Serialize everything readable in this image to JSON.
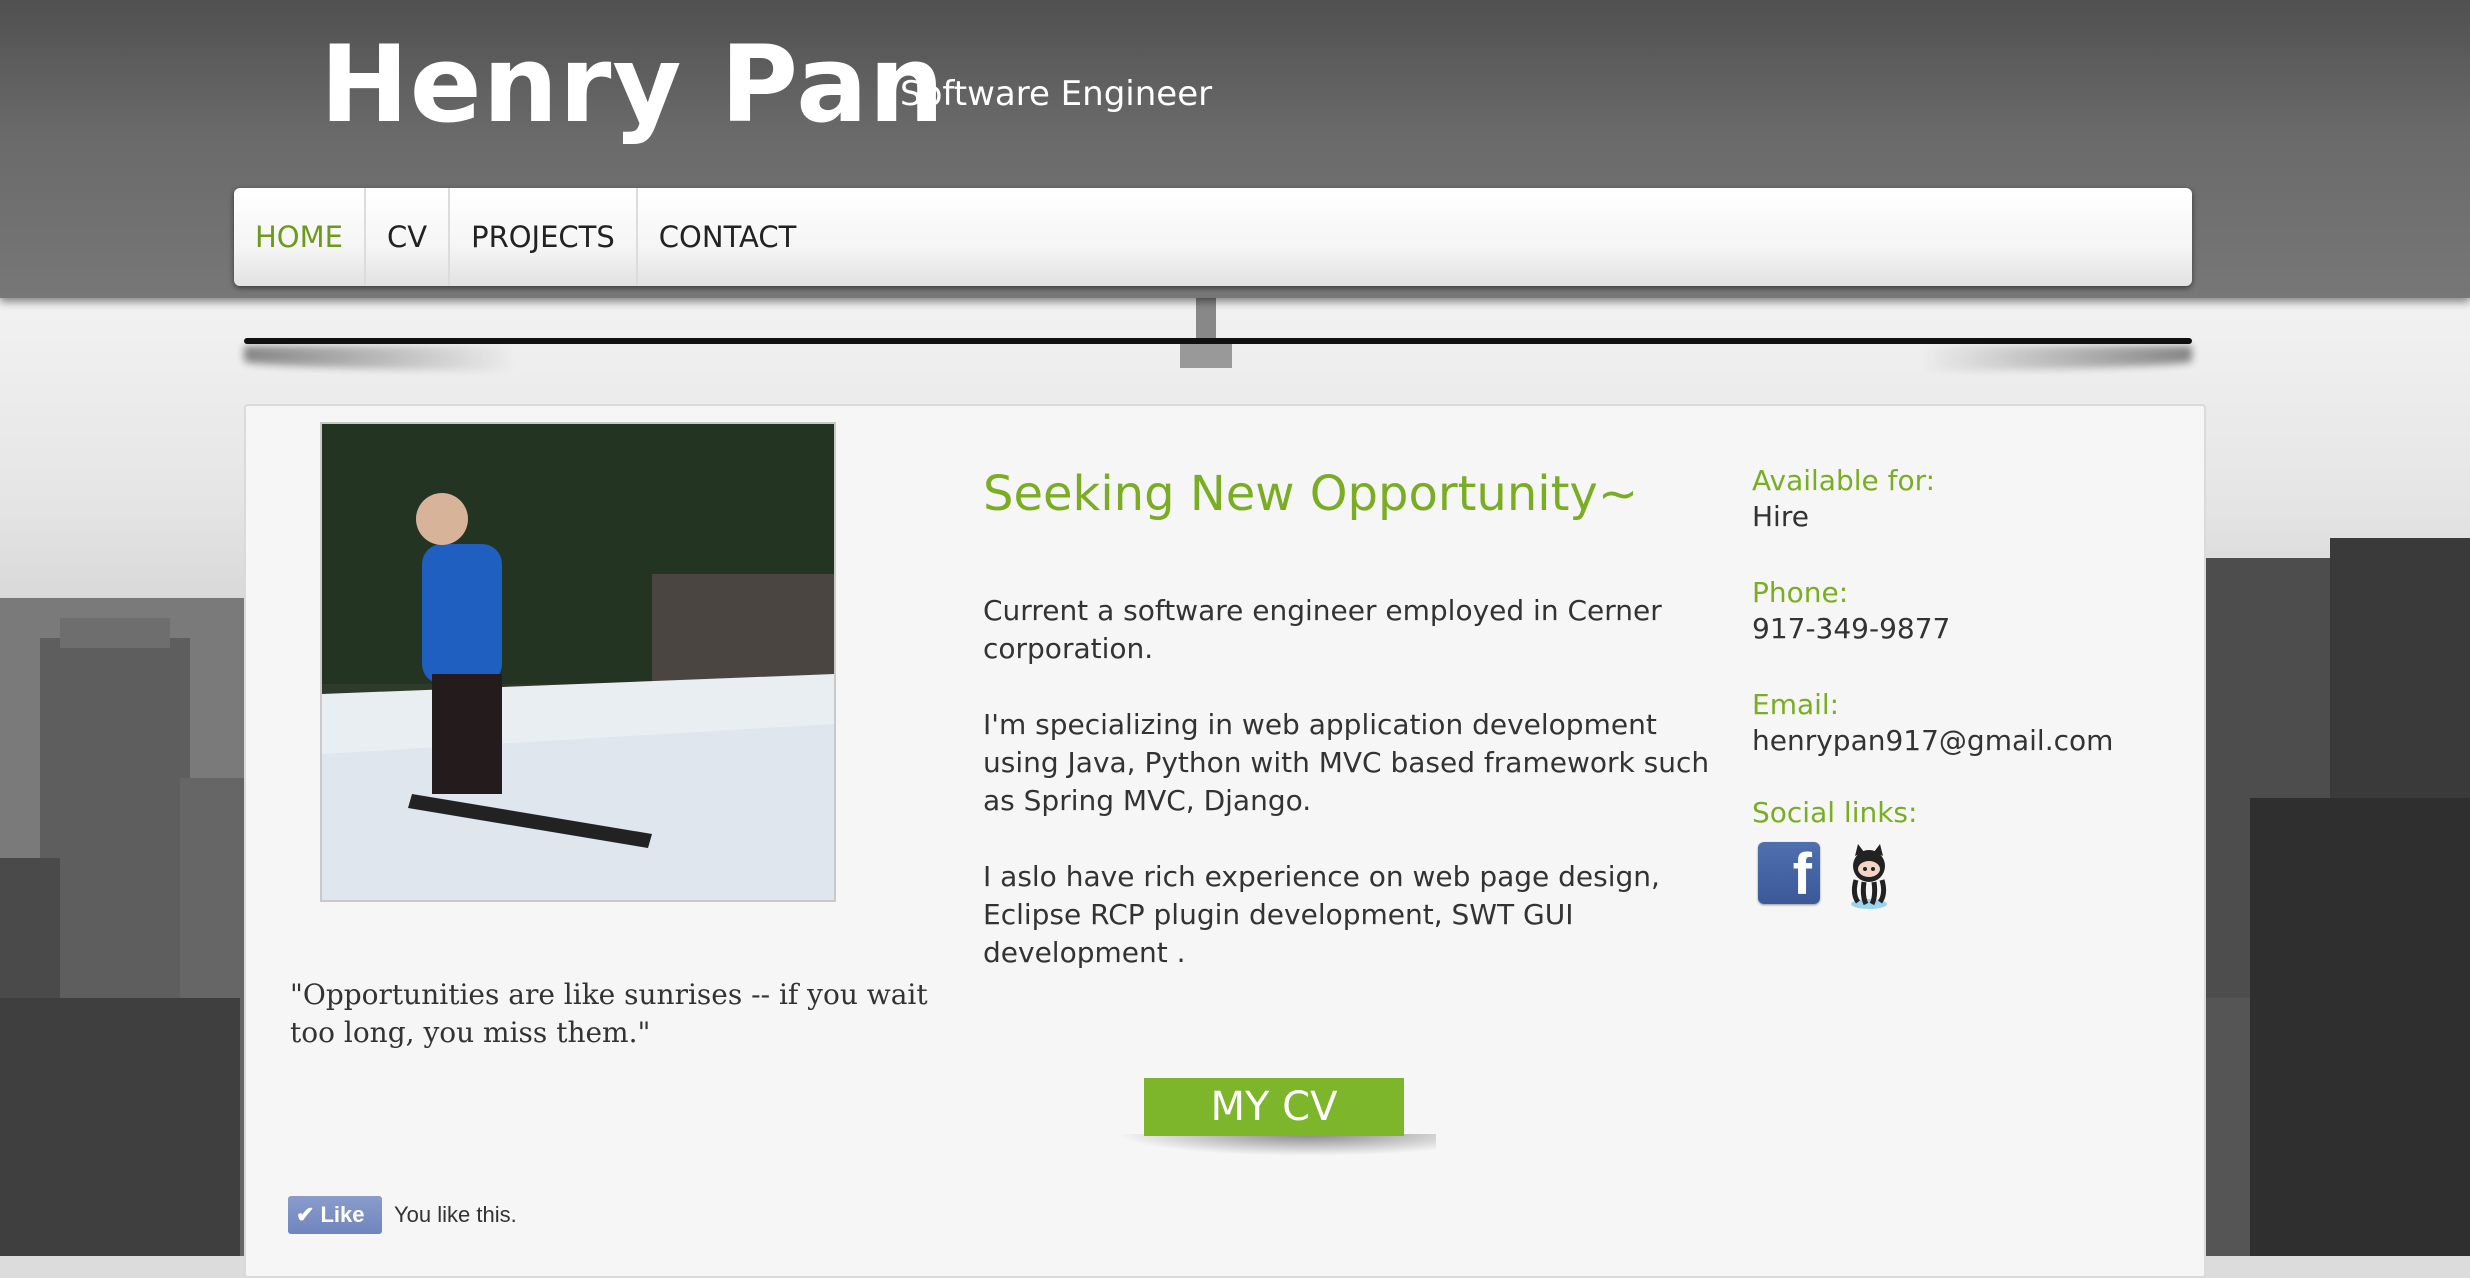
{
  "site": {
    "title": "Henry Pan",
    "subtitle": "Software Engineer"
  },
  "nav": {
    "items": [
      {
        "label": "HOME",
        "active": true
      },
      {
        "label": "CV",
        "active": false
      },
      {
        "label": "PROJECTS",
        "active": false
      },
      {
        "label": "CONTACT",
        "active": false
      }
    ]
  },
  "main": {
    "headline": "Seeking New Opportunity~",
    "paragraphs": [
      "Current a software engineer employed in Cerner corporation.",
      "I'm specializing in web application development using Java, Python with MVC based framework such as Spring MVC, Django.",
      "I aslo have rich experience on web page design, Eclipse RCP plugin development, SWT GUI development ."
    ],
    "quote": "\"Opportunities are like sunrises -- if you wait too long, you miss them.\"",
    "cv_button": "MY CV"
  },
  "info": {
    "available_label": "Available for:",
    "available_value": "Hire",
    "phone_label": "Phone:",
    "phone_value": "917-349-9877",
    "email_label": "Email:",
    "email_value": "henrypan917@gmail.com",
    "social_label": "Social links:",
    "social_icons": [
      "facebook-icon",
      "github-octocat-icon"
    ]
  },
  "like": {
    "button_label": "Like",
    "text": "You like this."
  },
  "colors": {
    "accent_green": "#7aad23",
    "header_gray": "#6a6a6a",
    "facebook_blue": "#3b5998"
  }
}
